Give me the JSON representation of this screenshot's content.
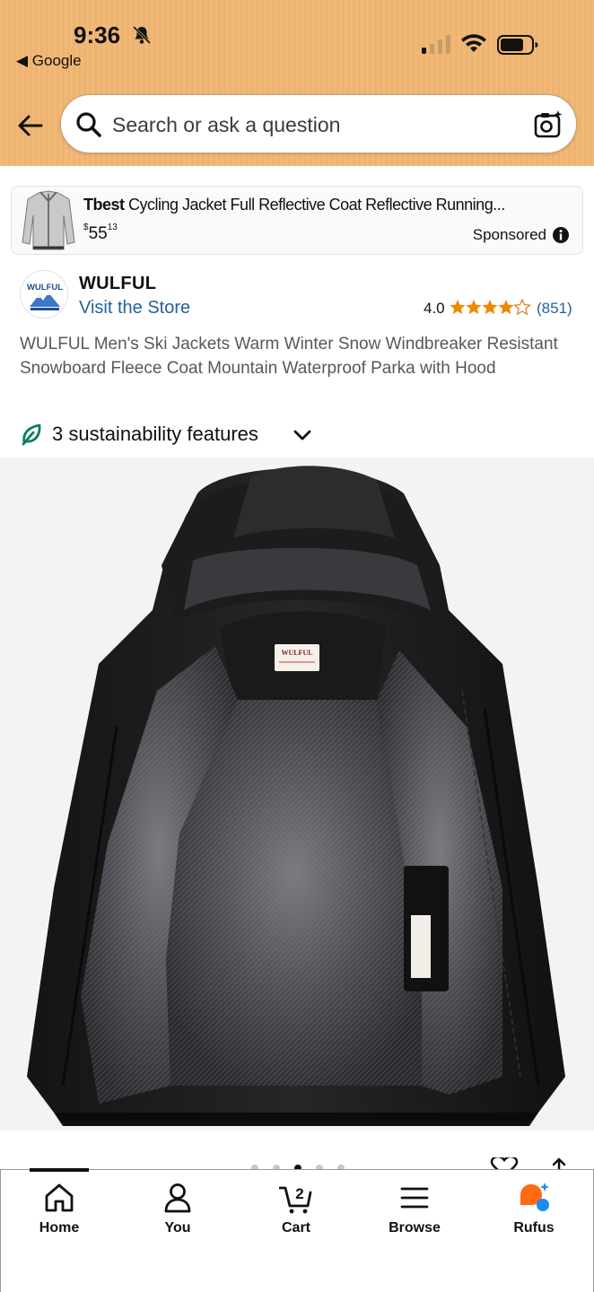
{
  "status_bar": {
    "time": "9:36",
    "back_app": "◀ Google"
  },
  "search": {
    "placeholder": "Search or ask a question"
  },
  "sponsored": {
    "brand": "Tbest",
    "title": " Cycling Jacket Full Reflective Coat Reflective Running...",
    "price_symbol": "$",
    "price_whole": "55",
    "price_fraction": "13",
    "label": "Sponsored"
  },
  "store": {
    "logo_text": "WULFUL",
    "brand_name": "WULFUL",
    "visit_label": "Visit the Store",
    "rating_value": "4.0",
    "rating_stars": 4.0,
    "rating_count": "(851)"
  },
  "product": {
    "title": "WULFUL Men's Ski Jackets Warm Winter Snow Windbreaker Resistant Snowboard Fleece Coat Mountain Waterproof Parka with Hood",
    "sustainability": "3 sustainability features",
    "image_label": "WULFUL"
  },
  "gallery": {
    "image_count": 5,
    "active_index": 2
  },
  "nav": {
    "items": [
      {
        "label": "Home",
        "icon": "home-icon"
      },
      {
        "label": "You",
        "icon": "person-icon"
      },
      {
        "label": "Cart",
        "icon": "cart-icon",
        "badge": "2"
      },
      {
        "label": "Browse",
        "icon": "menu-icon"
      },
      {
        "label": "Rufus",
        "icon": "rufus-icon"
      }
    ]
  },
  "colors": {
    "header": "#f0b978",
    "link": "#2162a1",
    "star": "#f08804",
    "sustain_leaf": "#067d62"
  }
}
